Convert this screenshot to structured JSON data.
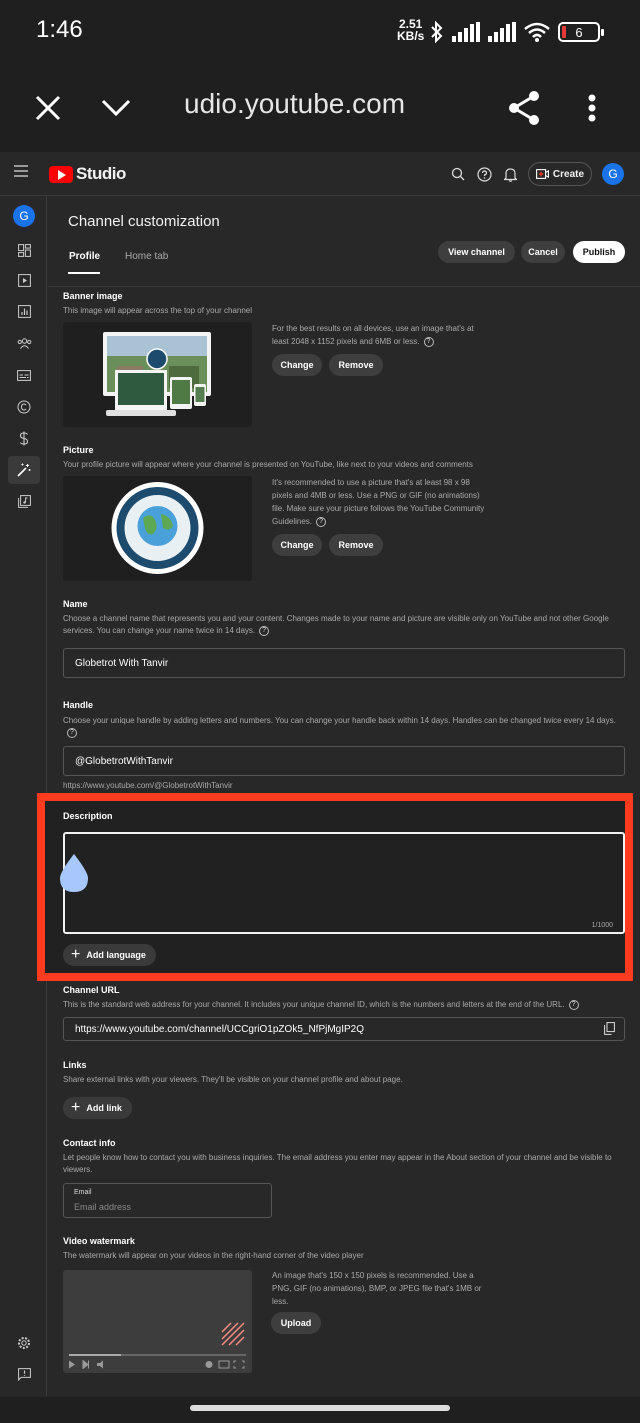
{
  "status": {
    "time": "1:46",
    "speed_value": "2.51",
    "speed_unit": "KB/s",
    "battery": "6"
  },
  "browser": {
    "url": "udio.youtube.com"
  },
  "header": {
    "logo_text": "Studio",
    "create_label": "Create",
    "avatar_letter": "G"
  },
  "page": {
    "title": "Channel customization",
    "tabs": [
      {
        "label": "Profile",
        "active": true
      },
      {
        "label": "Home tab",
        "active": false
      }
    ],
    "actions": {
      "view_channel": "View channel",
      "cancel": "Cancel",
      "publish": "Publish"
    }
  },
  "banner": {
    "title": "Banner image",
    "desc": "This image will appear across the top of your channel",
    "info": "For the best results on all devices, use an image that's at least 2048 x 1152 pixels and 6MB or less.",
    "change": "Change",
    "remove": "Remove"
  },
  "picture": {
    "title": "Picture",
    "desc": "Your profile picture will appear where your channel is presented on YouTube, like next to your videos and comments",
    "info": "It's recommended to use a picture that's at least 98 x 98 pixels and 4MB or less. Use a PNG or GIF (no animations) file. Make sure your picture follows the YouTube Community Guidelines.",
    "change": "Change",
    "remove": "Remove",
    "logo_text": "GLOBETROT WITH TANVIR"
  },
  "name": {
    "title": "Name",
    "desc": "Choose a channel name that represents you and your content. Changes made to your name and picture are visible only on YouTube and not other Google services. You can change your name twice in 14 days.",
    "value": "Globetrot With Tanvir"
  },
  "handle": {
    "title": "Handle",
    "desc": "Choose your unique handle by adding letters and numbers. You can change your handle back within 14 days. Handles can be changed twice every 14 days.",
    "value": "@GlobetrotWithTanvir",
    "url_hint": "https://www.youtube.com/@GlobetrotWithTanvir"
  },
  "description": {
    "title": "Description",
    "counter": "1/1000",
    "add_language": "Add language"
  },
  "channel_url": {
    "title": "Channel URL",
    "desc": "This is the standard web address for your channel. It includes your unique channel ID, which is the numbers and letters at the end of the URL.",
    "value": "https://www.youtube.com/channel/UCCgriO1pZOk5_NfPjMgIP2Q"
  },
  "links": {
    "title": "Links",
    "desc": "Share external links with your viewers. They'll be visible on your channel profile and about page.",
    "add_link": "Add link"
  },
  "contact": {
    "title": "Contact info",
    "desc": "Let people know how to contact you with business inquiries. The email address you enter may appear in the About section of your channel and be visible to viewers.",
    "email_label": "Email",
    "email_placeholder": "Email address"
  },
  "watermark": {
    "title": "Video watermark",
    "desc": "The watermark will appear on your videos in the right-hand corner of the video player",
    "info": "An image that's 150 x 150 pixels is recommended. Use a PNG, GIF (no animations), BMP, or JPEG file that's 1MB or less.",
    "upload": "Upload"
  },
  "colors": {
    "highlight": "#ff3b1f",
    "brand_red": "#ff0000",
    "avatar_blue": "#1a73e8"
  }
}
